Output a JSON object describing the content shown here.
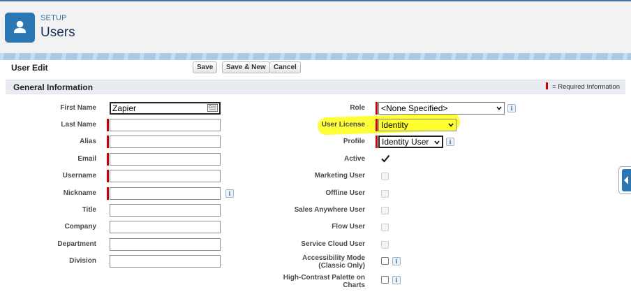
{
  "header": {
    "breadcrumb": "SETUP",
    "title": "Users"
  },
  "panel": {
    "title": "User Edit",
    "buttons": {
      "save": "Save",
      "save_new": "Save & New",
      "cancel": "Cancel"
    }
  },
  "section": {
    "title": "General Information",
    "required_legend": "= Required Information"
  },
  "left_fields": {
    "first_name": {
      "label": "First Name",
      "value": "Zapier"
    },
    "last_name": {
      "label": "Last Name",
      "value": ""
    },
    "alias": {
      "label": "Alias",
      "value": ""
    },
    "email": {
      "label": "Email",
      "value": ""
    },
    "username": {
      "label": "Username",
      "value": ""
    },
    "nickname": {
      "label": "Nickname",
      "value": ""
    },
    "title": {
      "label": "Title",
      "value": ""
    },
    "company": {
      "label": "Company",
      "value": ""
    },
    "department": {
      "label": "Department",
      "value": ""
    },
    "division": {
      "label": "Division",
      "value": ""
    }
  },
  "right_fields": {
    "role": {
      "label": "Role",
      "value": "<None Specified>"
    },
    "user_license": {
      "label": "User License",
      "value": "Identity"
    },
    "profile": {
      "label": "Profile",
      "value": "Identity User"
    },
    "active": {
      "label": "Active",
      "checked": true
    },
    "marketing_user": {
      "label": "Marketing User",
      "checked": false
    },
    "offline_user": {
      "label": "Offline User",
      "checked": false
    },
    "sales_anywhere_user": {
      "label": "Sales Anywhere User",
      "checked": false
    },
    "flow_user": {
      "label": "Flow User",
      "checked": false
    },
    "service_cloud_user": {
      "label": "Service Cloud User",
      "checked": false
    },
    "accessibility_mode": {
      "label_line1": "Accessibility Mode",
      "label_line2": "(Classic Only)",
      "checked": false
    },
    "high_contrast": {
      "label_line1": "High-Contrast Palette on",
      "label_line2": "Charts",
      "checked": false
    }
  },
  "colors": {
    "accent": "#2a77b4",
    "required": "#cc0000",
    "highlight": "#ffff2e"
  },
  "icons": {
    "header": "user-icon",
    "info": "info-icon",
    "side_tab": "chevron-left-icon"
  },
  "info_glyph": "i"
}
